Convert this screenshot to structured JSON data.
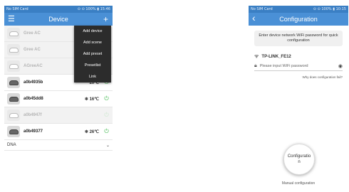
{
  "left": {
    "status": {
      "carrier": "No SIM Card",
      "right": "⊙ ⊙ 100% ▮ 15:46"
    },
    "appbar": {
      "title": "Device",
      "add_icon": "+"
    },
    "devices": [
      {
        "name": "Gree AC",
        "temp": "",
        "style": "grey"
      },
      {
        "name": "Gree AC",
        "temp": "",
        "style": "grey"
      },
      {
        "name": "AGreeAC",
        "temp": "",
        "style": "grey"
      },
      {
        "name": "a0b4935b",
        "temp": "20℃",
        "style": "dark"
      },
      {
        "name": "a0b45dd8",
        "temp": "❄ 16℃",
        "style": "dark"
      },
      {
        "name": "a0b4947f",
        "temp": "",
        "style": "grey"
      },
      {
        "name": "a0b49377",
        "temp": "❄ 26℃",
        "style": "dark"
      }
    ],
    "dna": {
      "label": "DNA",
      "chevron": "⌄"
    },
    "menu": [
      "Add device",
      "Add scene",
      "Add preset",
      "Presetlist",
      "Link"
    ]
  },
  "right": {
    "status": {
      "carrier": "No SIM Card",
      "right": "⊙ ⊙ 100% ▮ 10:15"
    },
    "appbar": {
      "title": "Configuration",
      "back": "‹"
    },
    "hint": "Enter device network WiFi password for quick configuration",
    "wifi_name": "TP-LINK_FE12",
    "password_placeholder": "Please input WiFi password",
    "link_text": "Why does configuration fail?",
    "button_label": "Configuratio n",
    "manual": "Manual configuration"
  }
}
